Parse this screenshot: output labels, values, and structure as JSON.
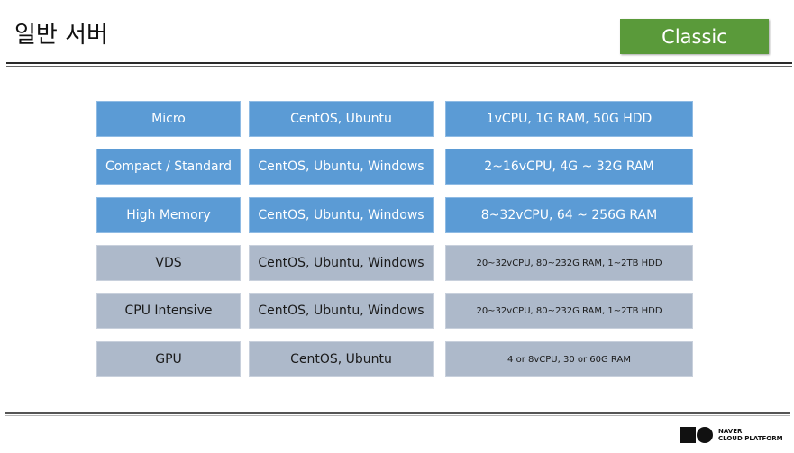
{
  "slide": {
    "title": "일반 서버",
    "badge": "Classic",
    "badge_color": "#5a9a3a"
  },
  "rows": [
    {
      "type": "Micro",
      "os": "CentOS, Ubuntu",
      "spec": "1vCPU, 1G RAM, 50G HDD",
      "style": "blue"
    },
    {
      "type": "Compact / Standard",
      "os": "CentOS, Ubuntu, Windows",
      "spec": "2~16vCPU, 4G ~ 32G RAM",
      "style": "blue"
    },
    {
      "type": "High Memory",
      "os": "CentOS, Ubuntu, Windows",
      "spec": "8~32vCPU, 64 ~ 256G RAM",
      "style": "blue"
    },
    {
      "type": "VDS",
      "os": "CentOS, Ubuntu, Windows",
      "spec": "20~32vCPU, 80~232G RAM, 1~2TB HDD",
      "style": "gray"
    },
    {
      "type": "CPU Intensive",
      "os": "CentOS, Ubuntu, Windows",
      "spec": "20~32vCPU, 80~232G RAM, 1~2TB HDD",
      "style": "gray"
    },
    {
      "type": "GPU",
      "os": "CentOS, Ubuntu",
      "spec": "4 or 8vCPU, 30 or 60G RAM",
      "style": "gray"
    }
  ],
  "colors": {
    "blue_cell": "#5b9bd5",
    "gray_cell": "#adb9ca"
  },
  "footer": {
    "logo_line1": "NAVER",
    "logo_line2": "CLOUD PLATFORM"
  }
}
